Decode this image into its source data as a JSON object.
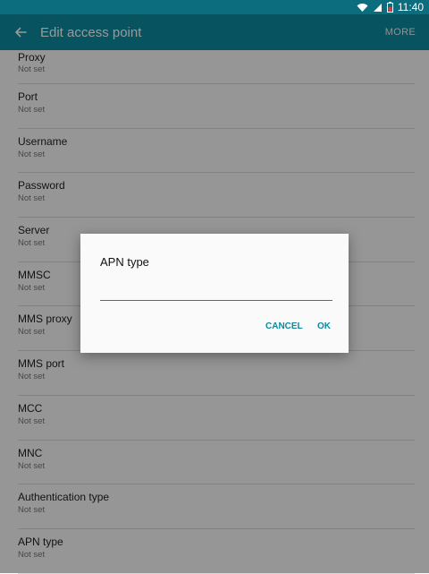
{
  "status": {
    "time": "11:40"
  },
  "appbar": {
    "title": "Edit access point",
    "more": "MORE"
  },
  "items": [
    {
      "label": "Proxy",
      "value": "Not set"
    },
    {
      "label": "Port",
      "value": "Not set"
    },
    {
      "label": "Username",
      "value": "Not set"
    },
    {
      "label": "Password",
      "value": "Not set"
    },
    {
      "label": "Server",
      "value": "Not set"
    },
    {
      "label": "MMSC",
      "value": "Not set"
    },
    {
      "label": "MMS proxy",
      "value": "Not set"
    },
    {
      "label": "MMS port",
      "value": "Not set"
    },
    {
      "label": "MCC",
      "value": "Not set"
    },
    {
      "label": "MNC",
      "value": "Not set"
    },
    {
      "label": "Authentication type",
      "value": "Not set"
    },
    {
      "label": "APN type",
      "value": "Not set"
    }
  ],
  "dialog": {
    "title": "APN type",
    "input_value": "",
    "cancel": "CANCEL",
    "ok": "OK"
  },
  "colors": {
    "status_bar": "#0b6d7e",
    "app_bar": "#0d8aa0",
    "accent": "#0d8aa0"
  },
  "icons": {
    "back": "arrow-back-icon",
    "wifi": "wifi-icon",
    "signal": "signal-icon",
    "battery": "battery-icon"
  }
}
